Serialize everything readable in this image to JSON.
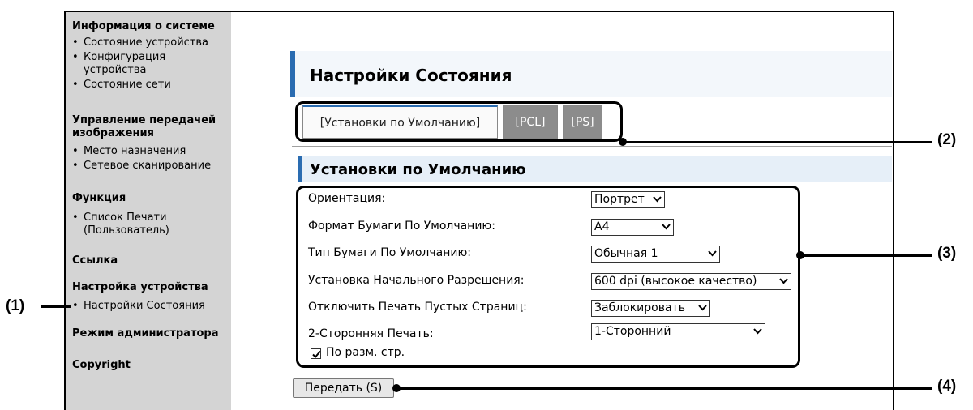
{
  "sidebar": {
    "sections": [
      {
        "title": "Информация о системе",
        "items": [
          "Состояние устройства",
          "Конфигурация устройства",
          "Состояние сети"
        ]
      },
      {
        "title": "Управление передачей изображения",
        "items": [
          "Место назначения",
          "Сетевое сканирование"
        ]
      },
      {
        "title": "Функция",
        "items": [
          "Список Печати (Пользователь)"
        ]
      },
      {
        "title": "Ссылка",
        "items": []
      },
      {
        "title": "Настройка устройства",
        "items": [
          "Настройки Состояния"
        ]
      },
      {
        "title": "Режим администратора",
        "items": []
      },
      {
        "title": "Copyright",
        "items": []
      }
    ]
  },
  "page": {
    "title": "Настройки Состояния"
  },
  "tabs": [
    "[Установки по Умолчанию]",
    "[PCL]",
    "[PS]"
  ],
  "subsection": {
    "title": "Установки по Умолчанию"
  },
  "form": {
    "rows": [
      {
        "label": "Ориентация:",
        "value": "Портрет"
      },
      {
        "label": "Формат Бумаги По Умолчанию:",
        "value": "A4"
      },
      {
        "label": "Тип Бумаги По Умолчанию:",
        "value": "Обычная 1"
      },
      {
        "label": "Установка Начального Разрешения:",
        "value": "600 dpi (высокое качество)"
      },
      {
        "label": "Отключить Печать Пустых Страниц:",
        "value": "Заблокировать"
      },
      {
        "label": "2-Сторонняя Печать:",
        "value": "1-Сторонний"
      }
    ],
    "checkbox": {
      "label": "По разм. стр.",
      "checked": true
    },
    "submit_label": "Передать (S)"
  },
  "callouts": {
    "c1": "(1)",
    "c2": "(2)",
    "c3": "(3)",
    "c4": "(4)"
  },
  "colors": {
    "accent": "#2a6cb1",
    "sidebar_bg": "#d4d4d4",
    "tab_inactive": "#8c8c8c"
  }
}
